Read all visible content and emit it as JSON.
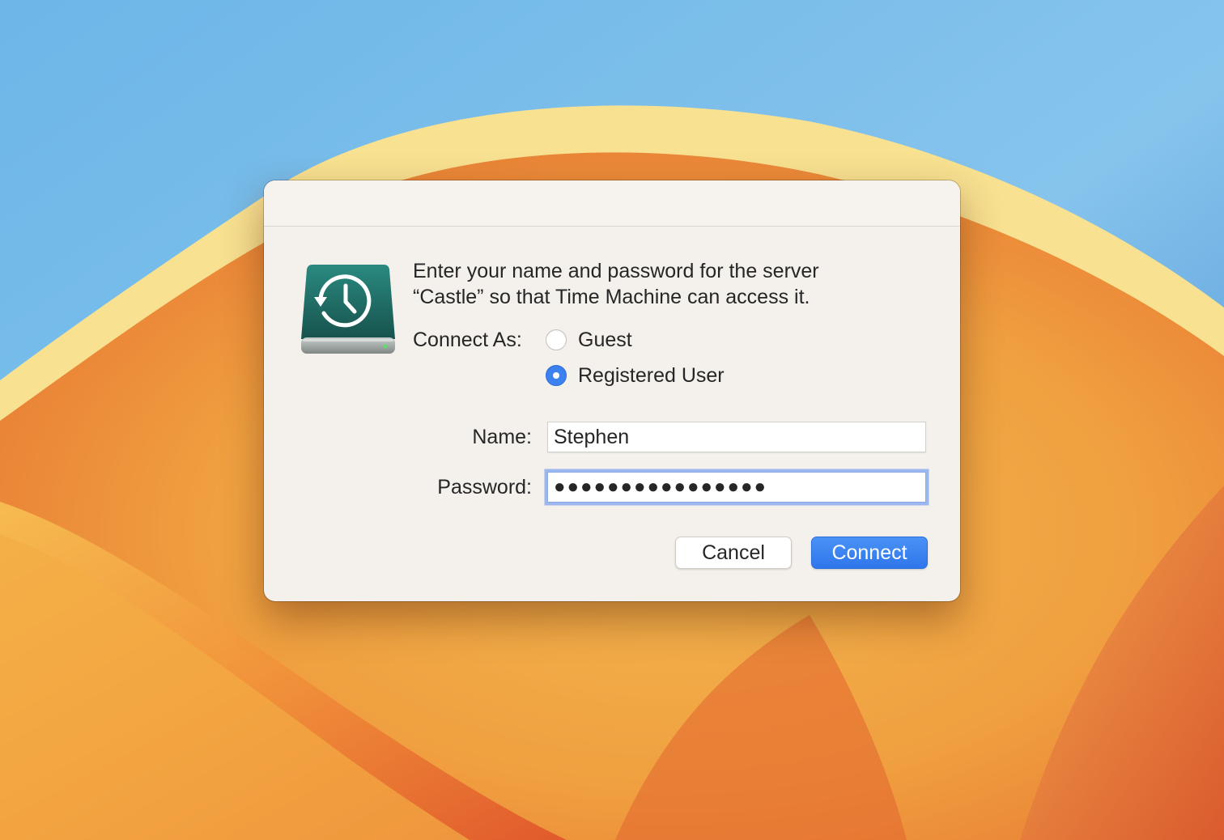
{
  "dialog": {
    "message_line1": "Enter your name and password for the server",
    "message_line2": "“Castle” so that Time Machine can access it.",
    "icon": "time-machine-drive-icon",
    "connect_as": {
      "label": "Connect As:",
      "options": [
        {
          "label": "Guest",
          "selected": false
        },
        {
          "label": "Registered User",
          "selected": true
        }
      ]
    },
    "name": {
      "label": "Name:",
      "value": "Stephen"
    },
    "password": {
      "label": "Password:",
      "value": "●●●●●●●●●●●●●●●●"
    },
    "buttons": {
      "cancel": "Cancel",
      "connect": "Connect"
    }
  },
  "colors": {
    "accent": "#3b82f0",
    "dialog_background": "#f4f1ec",
    "focus_ring": "#9bb7ee",
    "drive_teal": "#1f6d66"
  }
}
